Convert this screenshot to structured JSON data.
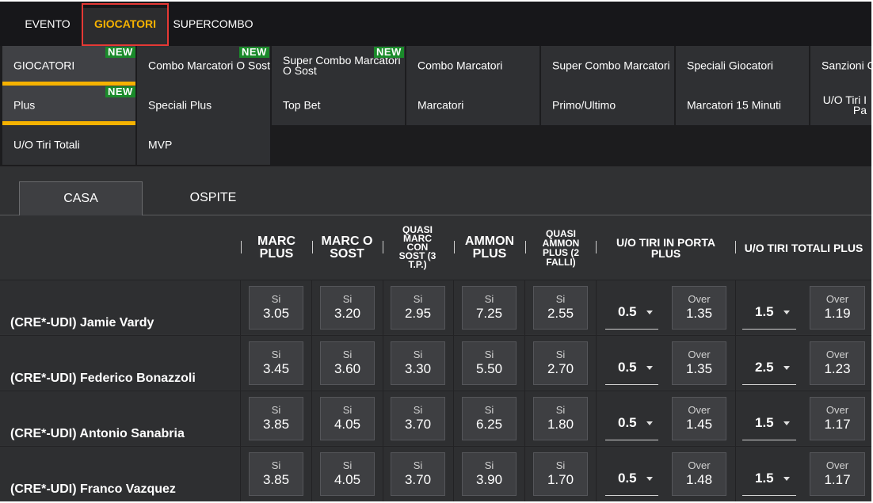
{
  "top_tabs": [
    "EVENTO",
    "GIOCATORI",
    "SUPERCOMBO"
  ],
  "new_badge": "NEW",
  "subcategories": [
    [
      "GIOCATORI",
      "Combo Marcatori O Sost",
      "Super Combo Marcatori O Sost",
      "Combo Marcatori",
      "Super Combo Marcatori",
      "Speciali Giocatori",
      "Sanzioni G"
    ],
    [
      "Plus",
      "Speciali Plus",
      "Top Bet",
      "Marcatori",
      "Primo/Ultimo",
      "Marcatori 15 Minuti",
      "U/O Tiri I Pa"
    ],
    [
      "U/O Tiri Totali",
      "MVP"
    ]
  ],
  "team_tabs": [
    "CASA",
    "OSPITE"
  ],
  "columns": [
    [
      "MARC",
      "PLUS"
    ],
    [
      "MARC O",
      "SOST"
    ],
    [
      "QUASI",
      "MARC",
      "CON",
      "SOST (3",
      "T.P.)"
    ],
    [
      "AMMON",
      "PLUS"
    ],
    [
      "QUASI",
      "AMMON",
      "PLUS (2",
      "FALLI)"
    ],
    [
      "U/O TIRI IN PORTA",
      "PLUS"
    ],
    [
      "U/O TIRI TOTALI PLUS"
    ]
  ],
  "odd_label": "Si",
  "over_label": "Over",
  "players": [
    {
      "name": "(CRE*-UDI) Jamie Vardy",
      "odds": [
        "3.05",
        "3.20",
        "2.95",
        "7.25",
        "2.55"
      ],
      "porta_line": "0.5",
      "porta_over": "1.35",
      "totali_line": "1.5",
      "totali_over": "1.19"
    },
    {
      "name": "(CRE*-UDI) Federico Bonazzoli",
      "odds": [
        "3.45",
        "3.60",
        "3.30",
        "5.50",
        "2.70"
      ],
      "porta_line": "0.5",
      "porta_over": "1.35",
      "totali_line": "2.5",
      "totali_over": "1.23"
    },
    {
      "name": "(CRE*-UDI) Antonio Sanabria",
      "odds": [
        "3.85",
        "4.05",
        "3.70",
        "6.25",
        "1.80"
      ],
      "porta_line": "0.5",
      "porta_over": "1.45",
      "totali_line": "1.5",
      "totali_over": "1.17"
    },
    {
      "name": "(CRE*-UDI) Franco Vazquez",
      "odds": [
        "3.85",
        "4.05",
        "3.70",
        "3.90",
        "1.70"
      ],
      "porta_line": "0.5",
      "porta_over": "1.48",
      "totali_line": "1.5",
      "totali_over": "1.17"
    }
  ],
  "colors": {
    "accent": "#f6b200",
    "new_badge": "#1a8a2a",
    "highlight_box": "#e53935"
  },
  "icons": [
    "chevron-down-icon"
  ]
}
